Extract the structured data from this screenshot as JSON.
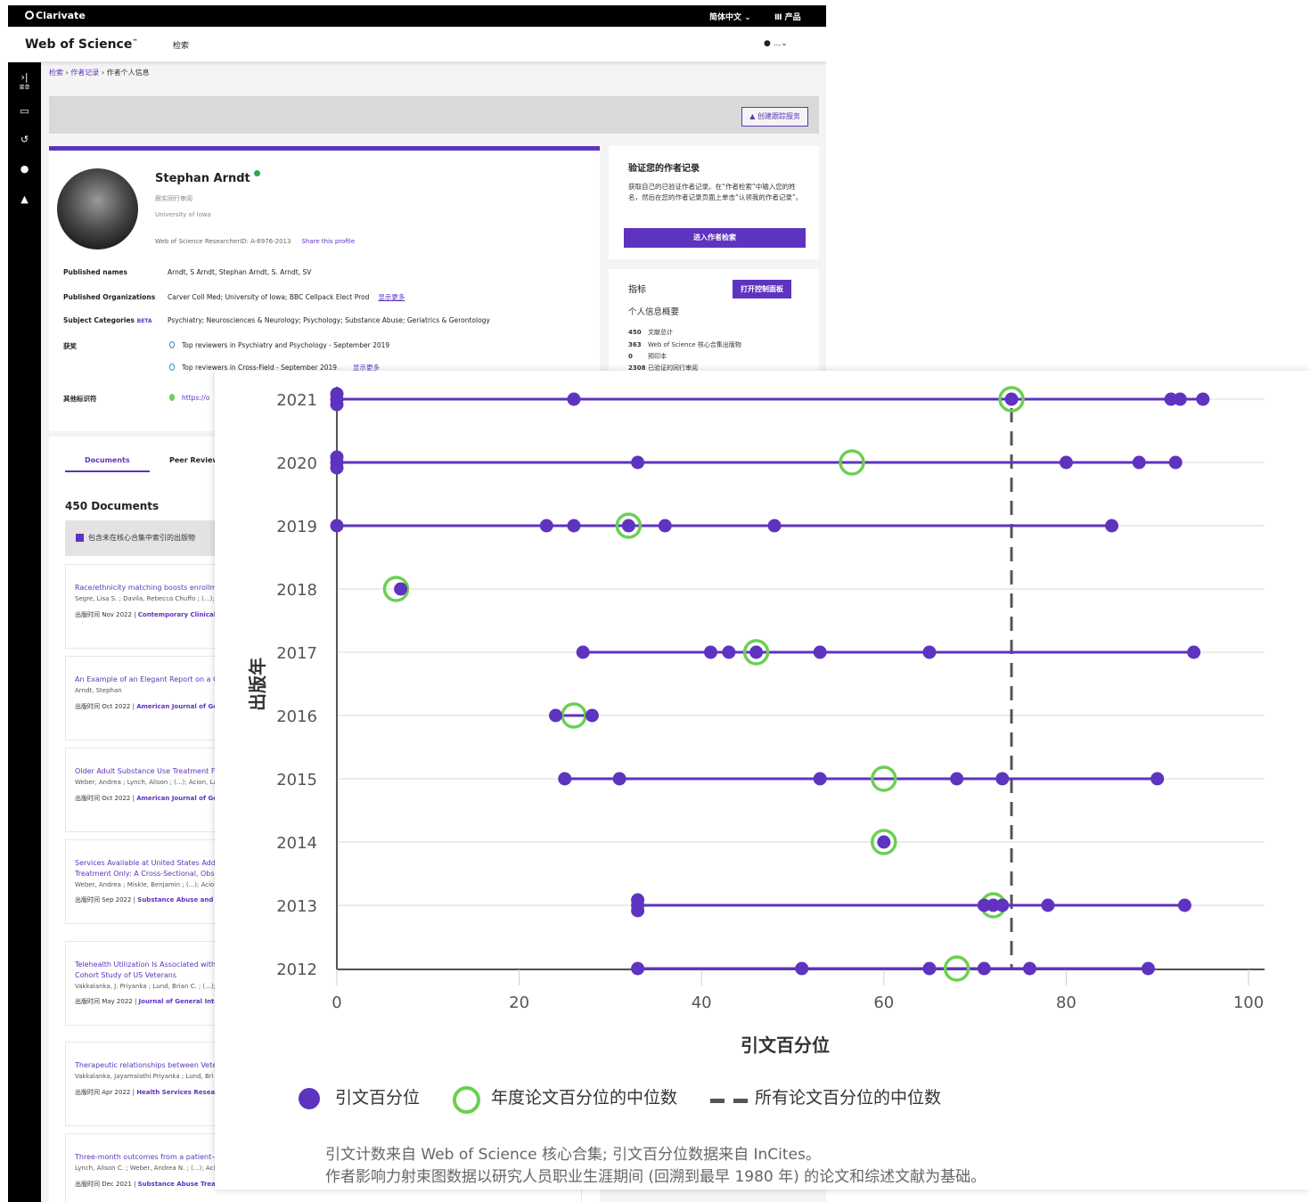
{
  "wos": {
    "brand": "Clarivate",
    "language": "简体中文 ⌄",
    "products": "Ⅲ 产品",
    "app_title": "Web of Science",
    "app_title_tm": "™",
    "nav_search": "检索",
    "user_menu": "...⌄",
    "rail": {
      "menu_label": "菜单"
    },
    "breadcrumb": {
      "search": "检索",
      "author_records": "作者记录",
      "current": "作者个人信息"
    },
    "create_tracking": "创建跟踪服务",
    "profile": {
      "name": "Stephan Arndt",
      "verified_reviews": "跟实同行审阅",
      "affiliation": "University of Iowa",
      "researcher_id": "Web of Science ResearcherID: A-6976-2013",
      "share": "Share this profile",
      "published_names_label": "Published names",
      "published_names": "Arndt, S    Arndt, Stephan    Arndt, S.    Arndt, SV",
      "published_orgs_label": "Published Organizations",
      "published_orgs": "Carver Coll Med;  University of Iowa;  BBC Cellpack Elect Prod",
      "show_more": "显示更多",
      "subject_label": "Subject Categories",
      "beta": "BETA",
      "subjects": "Psychiatry;  Neurosciences & Neurology;  Psychology;  Substance Abuse;  Geriatrics & Gerontology",
      "awards_label": "获奖",
      "award1": "Top reviewers in Psychiatry and Psychology - September 2019",
      "award2": "Top reviewers in Cross-Field - September 2019",
      "other_ids_label": "其他标识符",
      "other_id": "https://o"
    },
    "verify": {
      "title": "验证您的作者记录",
      "text": "获取自己的已验证作者记录。在“作者检索”中输入您的姓名，然后在您的作者记录页面上单击“认领我的作者记录”。",
      "button": "进入作者检索"
    },
    "metrics": {
      "title": "指标",
      "dashboard_button": "打开控制面板",
      "overview": "个人信息概要",
      "rows": [
        {
          "value": "450",
          "label": "文献总计"
        },
        {
          "value": "363",
          "label": "Web of Science 核心合集出版物"
        },
        {
          "value": "0",
          "label": "预印本"
        },
        {
          "value": "2308",
          "label": "已验证的同行审阅"
        }
      ]
    },
    "documents": {
      "tab_documents": "Documents",
      "tab_peer": "Peer Review",
      "count": "450 Documents",
      "include_label": "包含未在核心合集中索引的出版物",
      "items": [
        {
          "title": "Race/ethnicity matching boosts enrollm",
          "authors": "Segre, Lisa S. ; Davila, Rebecca Chuffo ; (...); A",
          "date": "出版时间 Nov 2022 | ",
          "journal": "Contemporary Clinical Tri"
        },
        {
          "title": "An Example of an Elegant Report on a Co",
          "authors": "Arndt, Stephan",
          "date": "出版时间 Oct 2022 | ",
          "journal": "American Journal of Geria"
        },
        {
          "title": "Older Adult Substance Use Treatment Fi",
          "authors": "Weber, Andrea ; Lynch, Alison ; (...); Acion, La",
          "date": "出版时间 Oct 2022 | ",
          "journal": "American Journal of Geria"
        },
        {
          "title": "Services Available at United States Addic",
          "title2": "Treatment Only: A Cross-Sectional, Obse",
          "authors": "Weber, Andrea ; Miskle, Benjamin ; (...); Acion",
          "date": "出版时间 Sep 2022 | ",
          "journal": "Substance Abuse and Reh"
        },
        {
          "title": "Telehealth Utilization Is Associated with",
          "title2": "Cohort Study of US Veterans",
          "authors": "Vakkalanka, J. Priyanka ; Lund, Brian C. ; (...);",
          "date": "出版时间 May 2022 | ",
          "journal": "Journal of General Intern"
        },
        {
          "title": "Therapeutic relationships between Vete",
          "authors": "Vakkalanka, Jayamalathi Priyanka ; Lund, Bri",
          "date": "出版时间 Apr 2022 | ",
          "journal": "Health Services Research"
        },
        {
          "title": "Three-month outcomes from a patient-c",
          "authors": "Lynch, Alison C. ; Weber, Andrea N. ; (...); Acio",
          "date": "出版时间 Dec 2021 | ",
          "journal": "Substance Abuse Treatme"
        }
      ]
    }
  },
  "chart_data": {
    "type": "scatter",
    "ylabel": "出版年",
    "xlabel": "引文百分位",
    "xlim": [
      0,
      100
    ],
    "xticks": [
      0,
      20,
      40,
      60,
      80,
      100
    ],
    "overall_median": 74,
    "years": [
      {
        "year": "2021",
        "points": [
          0,
          0,
          0,
          26,
          74,
          91.5,
          92.5,
          95
        ],
        "median": 74
      },
      {
        "year": "2020",
        "points": [
          0,
          0,
          0,
          33,
          80,
          88,
          92
        ],
        "median": 56.5
      },
      {
        "year": "2019",
        "points": [
          0,
          23,
          26,
          32,
          36,
          48,
          85
        ],
        "median": 32
      },
      {
        "year": "2018",
        "points": [
          7
        ],
        "median": 6.5
      },
      {
        "year": "2017",
        "points": [
          27,
          41,
          43,
          46,
          53,
          65,
          94
        ],
        "median": 46
      },
      {
        "year": "2016",
        "points": [
          24,
          28
        ],
        "median": 26
      },
      {
        "year": "2015",
        "points": [
          25,
          31,
          53,
          68,
          73,
          90
        ],
        "median": 60
      },
      {
        "year": "2014",
        "points": [
          60
        ],
        "median": 60
      },
      {
        "year": "2013",
        "points": [
          33,
          33,
          33,
          71,
          72,
          73,
          78,
          93
        ],
        "median": 72
      },
      {
        "year": "2012",
        "points": [
          33,
          51,
          65,
          71,
          76,
          89
        ],
        "median": 68
      }
    ],
    "legend": [
      "引文百分位",
      "年度论文百分位的中位数",
      "所有论文百分位的中位数"
    ],
    "colors": {
      "points": "#5e33bf",
      "median_ring": "#6ccf52",
      "overall_line": "#555555",
      "grid": "#e6e6e6"
    },
    "footnote_line1": "引文计数来自 Web of Science 核心合集; 引文百分位数据来自 InCites。",
    "footnote_line2": "作者影响力射束图数据以研究人员职业生涯期间 (回溯到最早 1980 年) 的论文和综述文献为基础。"
  }
}
